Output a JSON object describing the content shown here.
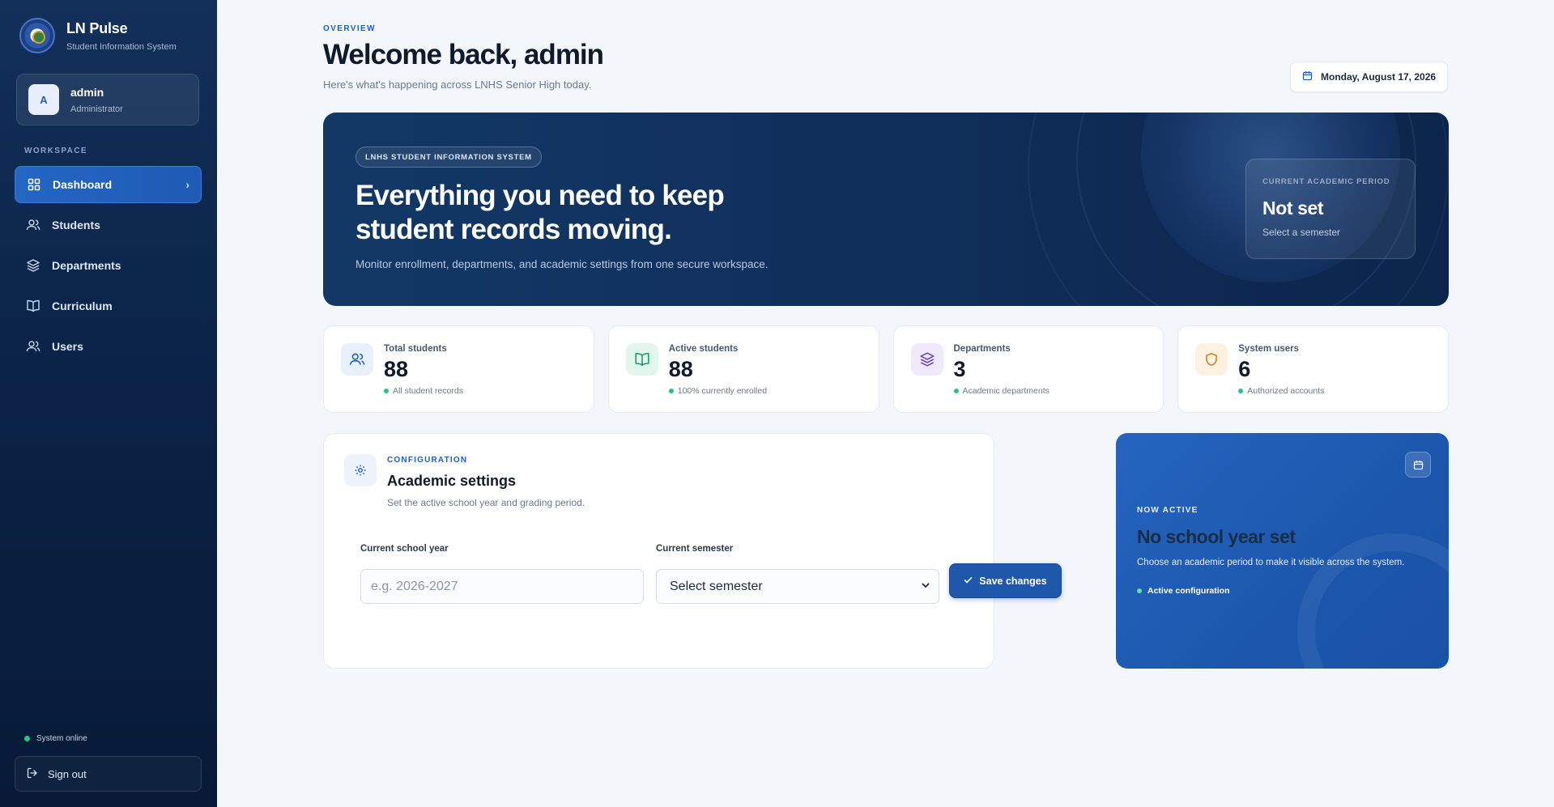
{
  "brand": {
    "title": "LN Pulse",
    "subtitle": "Student Information System"
  },
  "user": {
    "initial": "A",
    "name": "admin",
    "role": "Administrator"
  },
  "sidebar": {
    "section_label": "WORKSPACE",
    "items": [
      {
        "label": "Dashboard",
        "icon": "grid-icon",
        "active": true
      },
      {
        "label": "Students",
        "icon": "users-icon"
      },
      {
        "label": "Departments",
        "icon": "layers-icon"
      },
      {
        "label": "Curriculum",
        "icon": "book-icon"
      },
      {
        "label": "Users",
        "icon": "users-icon"
      }
    ],
    "status": "System online",
    "signout": "Sign out"
  },
  "header": {
    "eyebrow": "OVERVIEW",
    "title": "Welcome back, admin",
    "subtitle": "Here's what's happening across LNHS Senior High today.",
    "date": "Monday, August 17, 2026"
  },
  "hero": {
    "pill": "LNHS STUDENT INFORMATION SYSTEM",
    "title_line1": "Everything you need to keep",
    "title_line2": "student records moving.",
    "subtitle": "Monitor enrollment, departments, and academic settings from one secure workspace.",
    "period_label": "CURRENT ACADEMIC PERIOD",
    "period_value": "Not set",
    "period_hint": "Select a semester"
  },
  "stats": [
    {
      "label": "Total students",
      "value": "88",
      "note": "All student records",
      "icon": "users-icon",
      "tint": "#e8f0fc",
      "color": "#1f5fbf"
    },
    {
      "label": "Active students",
      "value": "88",
      "note": "100% currently enrolled",
      "icon": "book-open-icon",
      "tint": "#e3f6ee",
      "color": "#18996b"
    },
    {
      "label": "Departments",
      "value": "3",
      "note": "Academic departments",
      "icon": "layers-icon",
      "tint": "#efe9fb",
      "color": "#6b46c1"
    },
    {
      "label": "System users",
      "value": "6",
      "note": "Authorized accounts",
      "icon": "shield-icon",
      "tint": "#fdf1e1",
      "color": "#c9811d"
    }
  ],
  "config": {
    "eyebrow": "CONFIGURATION",
    "title": "Academic settings",
    "subtitle": "Set the active school year and grading period.",
    "school_year_label": "Current school year",
    "school_year_placeholder": "e.g. 2026-2027",
    "semester_label": "Current semester",
    "semester_value": "Select semester",
    "save_label": "Save changes"
  },
  "active": {
    "eyebrow": "NOW ACTIVE",
    "title": "No school year set",
    "subtitle": "Choose an academic period to make it visible across the system.",
    "tag": "Active configuration"
  }
}
